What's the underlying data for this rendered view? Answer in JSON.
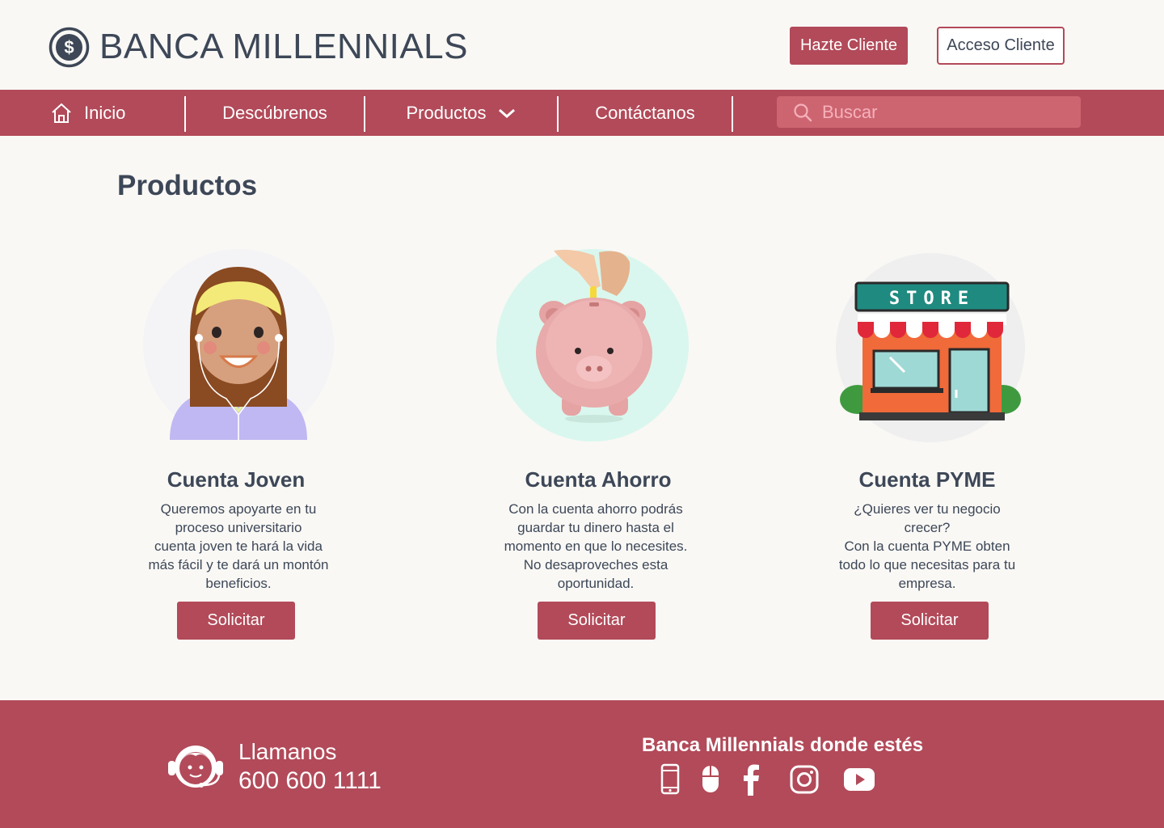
{
  "header": {
    "brand": "BANCA MILLENNIALS",
    "join_label": "Hazte Cliente",
    "access_label": "Acceso Cliente"
  },
  "nav": {
    "items": [
      {
        "label": "Inicio"
      },
      {
        "label": "Descúbrenos"
      },
      {
        "label": "Productos"
      },
      {
        "label": "Contáctanos"
      }
    ],
    "search_placeholder": "Buscar"
  },
  "main": {
    "title": "Productos",
    "cards": [
      {
        "title": "Cuenta Joven",
        "description_lines": [
          "Queremos apoyarte en tu",
          "proceso universitario",
          "cuenta joven te hará la vida",
          "más fácil y te dará un montón",
          "beneficios."
        ],
        "button": "Solicitar",
        "illustration": "young-woman-with-earphones"
      },
      {
        "title": "Cuenta Ahorro",
        "description_lines": [
          "Con la cuenta ahorro podrás",
          "guardar tu dinero hasta el",
          "momento en que lo necesites.",
          "No desaproveches esta",
          "oportunidad."
        ],
        "button": "Solicitar",
        "illustration": "piggy-bank-with-coin"
      },
      {
        "title": "Cuenta PYME",
        "description_lines": [
          "¿Quieres ver tu negocio",
          "crecer?",
          "Con la cuenta PYME obten",
          "todo lo que necesitas para tu",
          "empresa."
        ],
        "button": "Solicitar",
        "illustration": "store-front",
        "store_sign": "STORE"
      }
    ]
  },
  "footer": {
    "call_label": "Llamanos",
    "call_number": "600 600 1111",
    "slogan": "Banca Millennials donde estés",
    "social_icons": [
      "mobile-icon",
      "mouse-icon",
      "facebook-icon",
      "instagram-icon",
      "youtube-icon"
    ]
  },
  "colors": {
    "primary": "#b24a59",
    "search_bg": "#cd6571",
    "text": "#3d4757",
    "background": "#f9f8f5"
  }
}
